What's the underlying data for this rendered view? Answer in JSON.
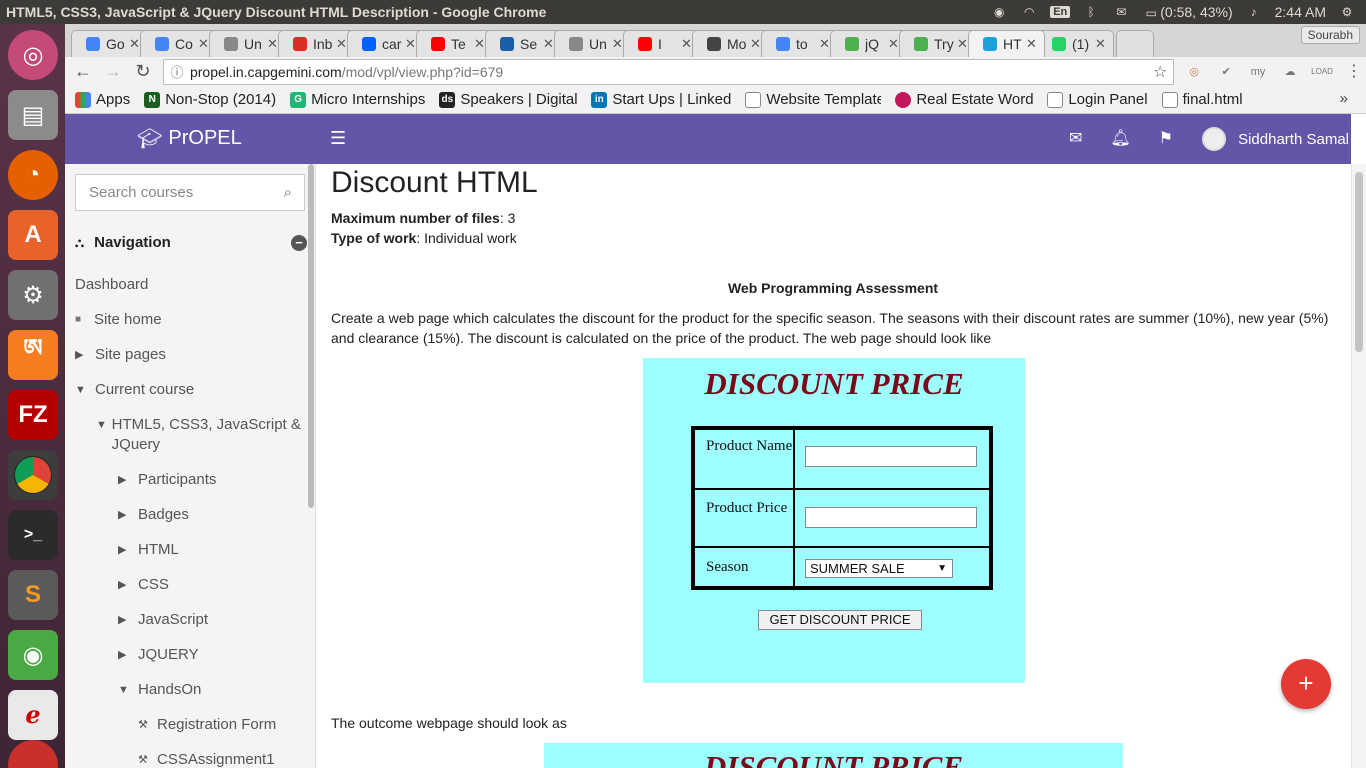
{
  "os": {
    "window_title": "HTML5, CSS3, JavaScript & JQuery Discount HTML Description - Google Chrome",
    "language": "En",
    "battery": "(0:58, 43%)",
    "time": "2:44 AM"
  },
  "tabs": [
    {
      "label": "Go",
      "icon": "google-icon",
      "color": "#4285f4"
    },
    {
      "label": "Co",
      "icon": "google-icon",
      "color": "#4285f4"
    },
    {
      "label": "Un",
      "icon": "page-icon",
      "color": "#888888"
    },
    {
      "label": "Inb",
      "icon": "gmail-icon",
      "color": "#d93025"
    },
    {
      "label": "car",
      "icon": "dropbox-icon",
      "color": "#0061ff"
    },
    {
      "label": "Te",
      "icon": "youtube-icon",
      "color": "#ff0000"
    },
    {
      "label": "Se",
      "icon": "sap-icon",
      "color": "#1a5fa8"
    },
    {
      "label": "Un",
      "icon": "page-icon",
      "color": "#888888"
    },
    {
      "label": "I",
      "icon": "youtube-icon",
      "color": "#ff0000"
    },
    {
      "label": "Mo",
      "icon": "square-icon",
      "color": "#444444"
    },
    {
      "label": "to",
      "icon": "google-icon",
      "color": "#4285f4"
    },
    {
      "label": "jQ",
      "icon": "w3-icon",
      "color": "#4caf50"
    },
    {
      "label": "Try",
      "icon": "w3-icon",
      "color": "#4caf50"
    },
    {
      "label": "HT",
      "icon": "propel-icon",
      "color": "#1ea0d8",
      "active": true
    },
    {
      "label": "(1)",
      "icon": "whatsapp-icon",
      "color": "#25d366"
    }
  ],
  "profile_name": "Sourabh",
  "omnibox": {
    "host": "propel.in.capgemini.com",
    "path": "/mod/vpl/view.php?id=679"
  },
  "bookmarks": [
    {
      "label": "Apps",
      "icon": "apps-icon",
      "color": "#e94235"
    },
    {
      "label": "Non-Stop (2014)",
      "icon": "movie-icon",
      "color": "#1b5e20"
    },
    {
      "label": "Micro Internships",
      "icon": "internship-icon",
      "color": "#22b573"
    },
    {
      "label": "Speakers | Digital",
      "icon": "ds-icon",
      "color": "#222222"
    },
    {
      "label": "Start Ups | LinkedIn",
      "icon": "linkedin-icon",
      "color": "#0077b5"
    },
    {
      "label": "Website Templates",
      "icon": "page-icon",
      "color": "#888888"
    },
    {
      "label": "Real Estate Word",
      "icon": "realestate-icon",
      "color": "#c2185b"
    },
    {
      "label": "Login Panel",
      "icon": "page-icon",
      "color": "#888888"
    },
    {
      "label": "final.html",
      "icon": "page-icon",
      "color": "#888888"
    }
  ],
  "header": {
    "brand": "PrOPEL",
    "user_name": "Siddharth Samal"
  },
  "sidebar": {
    "search_placeholder": "Search courses",
    "nav_title": "Navigation",
    "items": [
      {
        "label": "Dashboard"
      },
      {
        "label": "Site home"
      },
      {
        "label": "Site pages"
      },
      {
        "label": "Current course"
      },
      {
        "label": "HTML5, CSS3, JavaScript & JQuery"
      },
      {
        "label": "Participants"
      },
      {
        "label": "Badges"
      },
      {
        "label": "HTML"
      },
      {
        "label": "CSS"
      },
      {
        "label": "JavaScript"
      },
      {
        "label": "JQUERY"
      },
      {
        "label": "HandsOn"
      },
      {
        "label": "Registration Form"
      },
      {
        "label": "CSSAssignment1"
      }
    ]
  },
  "main": {
    "title": "Discount HTML",
    "max_files_label": "Maximum number of files",
    "max_files_value": ": 3",
    "work_type_label": "Type of work",
    "work_type_value": ": Individual work",
    "assessment_heading": "Web Programming Assessment",
    "description": "Create a web page which calculates the discount for the product for the specific season. The seasons with their discount rates are summer (10%), new year (5%) and clearance (15%). The discount is calculated on the price of the product. The web page should look like",
    "outcome_text": "The outcome webpage should look as"
  },
  "discount_form": {
    "title": "DISCOUNT PRICE",
    "product_name_label": "Product Name",
    "product_price_label": "Product Price",
    "season_label": "Season",
    "season_selected": "SUMMER SALE",
    "button_label": "GET DISCOUNT PRICE",
    "bg_color": "#9efefe",
    "title_color": "#7a0a1a"
  },
  "outcome_form": {
    "title": "DISCOUNT PRICE"
  }
}
